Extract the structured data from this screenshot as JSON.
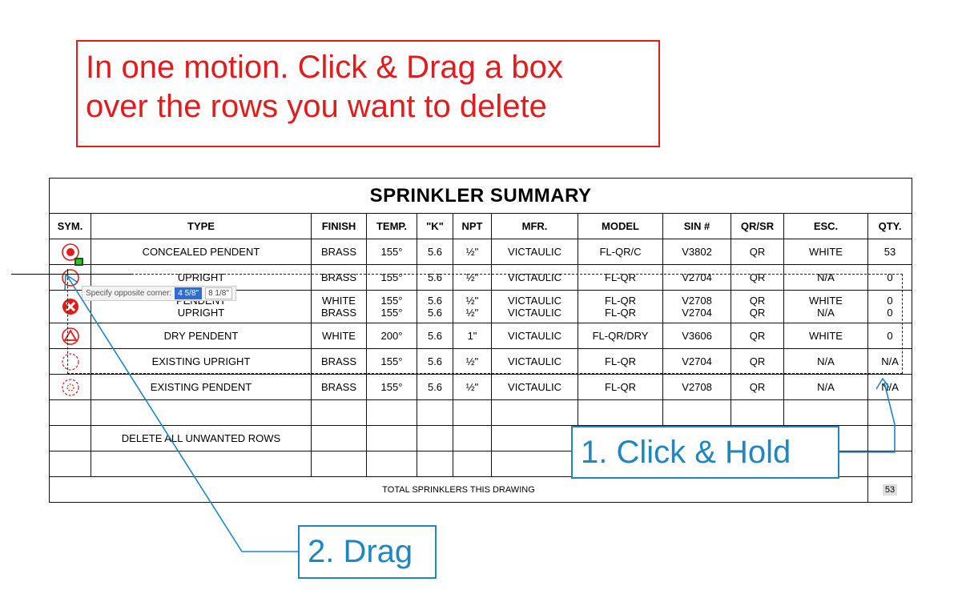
{
  "instruction": {
    "line1": "In one motion. Click & Drag a box",
    "line2": "over the rows you want to delete"
  },
  "table": {
    "title": "SPRINKLER SUMMARY",
    "headers": [
      "SYM.",
      "TYPE",
      "FINISH",
      "TEMP.",
      "\"K\"",
      "NPT",
      "MFR.",
      "MODEL",
      "SIN #",
      "QR/SR",
      "ESC.",
      "QTY."
    ],
    "rows": [
      {
        "symbol": "concealed-pendent-symbol-icon",
        "type": "CONCEALED PENDENT",
        "finish": "BRASS",
        "temp": "155°",
        "k": "5.6",
        "npt": "½\"",
        "mfr": "VICTAULIC",
        "model": "FL-QR/C",
        "sin": "V3802",
        "qrsr": "QR",
        "esc": "WHITE",
        "qty": "53"
      },
      {
        "symbol": "upright-symbol-icon",
        "type": "UPRIGHT",
        "finish": "BRASS",
        "temp": "155°",
        "k": "5.6",
        "npt": "½\"",
        "mfr": "VICTAULIC",
        "model": "FL-QR",
        "sin": "V2704",
        "qrsr": "QR",
        "esc": "N/A",
        "qty": "0"
      },
      {
        "symbol": "pendent-upright-symbol-icon",
        "type": "PENDENT\nUPRIGHT",
        "finish": "WHITE\nBRASS",
        "temp": "155°\n155°",
        "k": "5.6\n5.6",
        "npt": "½\"\n½\"",
        "mfr": "VICTAULIC\nVICTAULIC",
        "model": "FL-QR\nFL-QR",
        "sin": "V2708\nV2704",
        "qrsr": "QR\nQR",
        "esc": "WHITE\nN/A",
        "qty": "0\n0"
      },
      {
        "symbol": "dry-pendent-symbol-icon",
        "type": "DRY PENDENT",
        "finish": "WHITE",
        "temp": "200°",
        "k": "5.6",
        "npt": "1\"",
        "mfr": "VICTAULIC",
        "model": "FL-QR/DRY",
        "sin": "V3606",
        "qrsr": "QR",
        "esc": "WHITE",
        "qty": "0"
      },
      {
        "symbol": "existing-upright-symbol-icon",
        "type": "EXISTING UPRIGHT",
        "finish": "BRASS",
        "temp": "155°",
        "k": "5.6",
        "npt": "½\"",
        "mfr": "VICTAULIC",
        "model": "FL-QR",
        "sin": "V2704",
        "qrsr": "QR",
        "esc": "N/A",
        "qty": "N/A"
      },
      {
        "symbol": "existing-pendent-symbol-icon",
        "type": "EXISTING PENDENT",
        "finish": "BRASS",
        "temp": "155°",
        "k": "5.6",
        "npt": "½\"",
        "mfr": "VICTAULIC",
        "model": "FL-QR",
        "sin": "V2708",
        "qrsr": "QR",
        "esc": "N/A",
        "qty": "N/A"
      }
    ],
    "note": "DELETE ALL UNWANTED ROWS",
    "total_label": "TOTAL SPRINKLERS THIS DRAWING",
    "total_value": "53"
  },
  "tooltip": {
    "prompt": "Specify opposite corner:",
    "field1": "4 5/8\"",
    "field2": "8 1/8\""
  },
  "callouts": {
    "hold": "1. Click & Hold",
    "drag": "2. Drag"
  },
  "colors": {
    "instruction_red": "#e21b1b",
    "callout_blue": "#1f86c2",
    "symbol_red": "#e21b1b"
  }
}
